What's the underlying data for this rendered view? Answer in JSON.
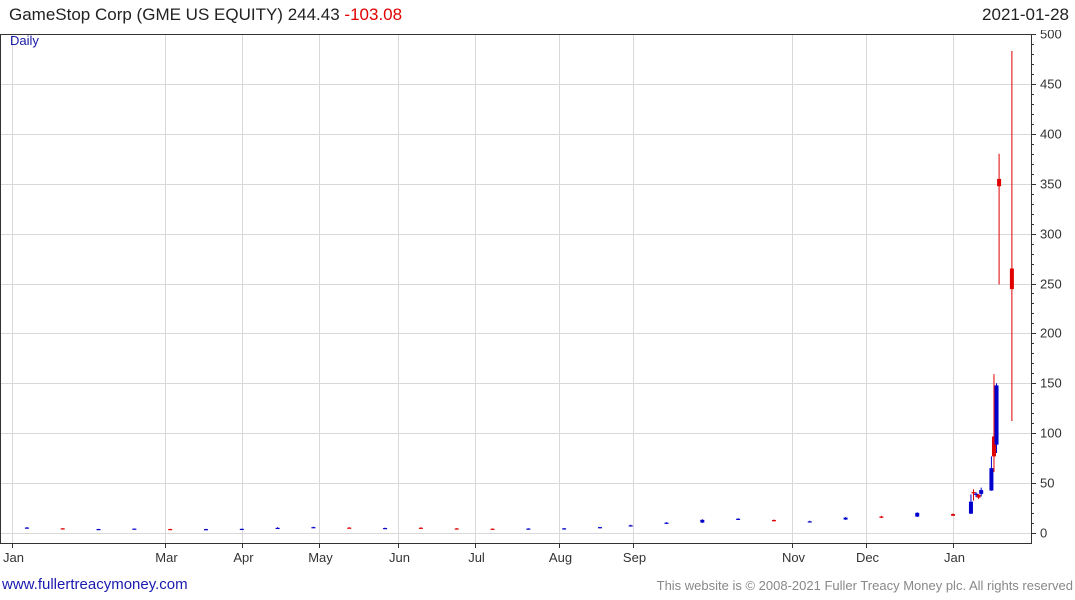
{
  "header": {
    "title": "GameStop Corp (GME US EQUITY)",
    "last_price": "244.43",
    "change": "-103.08",
    "date": "2021-01-28"
  },
  "footer": {
    "website": "www.fullertreacymoney.com",
    "copyright": "This website is © 2008-2021 Fuller Treacy Money plc. All rights reserved"
  },
  "colors": {
    "up": "#0000cc",
    "down": "#e00000",
    "grid": "#d8d8d8",
    "axis": "#333333"
  },
  "chart_data": {
    "type": "candlestick",
    "period_label": "Daily",
    "ylim": [
      -10,
      500
    ],
    "y_ticks": [
      0,
      50,
      100,
      150,
      200,
      250,
      300,
      350,
      400,
      450,
      500
    ],
    "x_ticks": [
      {
        "label": "Jan",
        "date": "2020-01-02"
      },
      {
        "label": "Mar",
        "date": "2020-03-02"
      },
      {
        "label": "Apr",
        "date": "2020-04-01"
      },
      {
        "label": "May",
        "date": "2020-05-01"
      },
      {
        "label": "Jun",
        "date": "2020-06-01"
      },
      {
        "label": "Jul",
        "date": "2020-07-01"
      },
      {
        "label": "Aug",
        "date": "2020-08-03"
      },
      {
        "label": "Sep",
        "date": "2020-09-01"
      },
      {
        "label": "Nov",
        "date": "2020-11-02"
      },
      {
        "label": "Dec",
        "date": "2020-12-01"
      },
      {
        "label": "Jan",
        "date": "2021-01-04"
      }
    ],
    "series": [
      {
        "date": "2020-01-08",
        "open": 5.2,
        "high": 5.9,
        "low": 4.9,
        "close": 5.5
      },
      {
        "date": "2020-01-22",
        "open": 4.7,
        "high": 5.0,
        "low": 4.4,
        "close": 4.5
      },
      {
        "date": "2020-02-05",
        "open": 3.8,
        "high": 4.2,
        "low": 3.5,
        "close": 4.0
      },
      {
        "date": "2020-02-19",
        "open": 4.1,
        "high": 4.5,
        "low": 3.9,
        "close": 4.4
      },
      {
        "date": "2020-03-04",
        "open": 4.0,
        "high": 4.3,
        "low": 3.6,
        "close": 3.7
      },
      {
        "date": "2020-03-18",
        "open": 3.8,
        "high": 4.2,
        "low": 3.2,
        "close": 3.9
      },
      {
        "date": "2020-04-01",
        "open": 3.9,
        "high": 4.4,
        "low": 3.6,
        "close": 4.2
      },
      {
        "date": "2020-04-15",
        "open": 5.0,
        "high": 5.8,
        "low": 4.7,
        "close": 5.2
      },
      {
        "date": "2020-04-29",
        "open": 5.5,
        "high": 6.3,
        "low": 5.2,
        "close": 5.9
      },
      {
        "date": "2020-05-13",
        "open": 5.4,
        "high": 5.9,
        "low": 4.9,
        "close": 5.1
      },
      {
        "date": "2020-05-27",
        "open": 4.9,
        "high": 5.4,
        "low": 4.6,
        "close": 5.0
      },
      {
        "date": "2020-06-10",
        "open": 5.3,
        "high": 5.8,
        "low": 4.9,
        "close": 5.1
      },
      {
        "date": "2020-06-24",
        "open": 4.6,
        "high": 5.0,
        "low": 4.2,
        "close": 4.4
      },
      {
        "date": "2020-07-08",
        "open": 4.3,
        "high": 4.6,
        "low": 3.9,
        "close": 4.1
      },
      {
        "date": "2020-07-22",
        "open": 4.3,
        "high": 4.8,
        "low": 4.1,
        "close": 4.5
      },
      {
        "date": "2020-08-05",
        "open": 4.5,
        "high": 5.0,
        "low": 4.2,
        "close": 4.7
      },
      {
        "date": "2020-08-19",
        "open": 5.2,
        "high": 6.1,
        "low": 5.0,
        "close": 5.9
      },
      {
        "date": "2020-08-31",
        "open": 7.3,
        "high": 8.3,
        "low": 7.0,
        "close": 7.7
      },
      {
        "date": "2020-09-14",
        "open": 9.5,
        "high": 10.8,
        "low": 9.2,
        "close": 10.4
      },
      {
        "date": "2020-09-28",
        "open": 10.5,
        "high": 13.8,
        "low": 10.1,
        "close": 13.2
      },
      {
        "date": "2020-10-12",
        "open": 13.5,
        "high": 14.8,
        "low": 13.0,
        "close": 14.3
      },
      {
        "date": "2020-10-26",
        "open": 13.0,
        "high": 13.6,
        "low": 11.5,
        "close": 12.0
      },
      {
        "date": "2020-11-09",
        "open": 11.2,
        "high": 12.3,
        "low": 10.9,
        "close": 11.7
      },
      {
        "date": "2020-11-23",
        "open": 13.5,
        "high": 15.9,
        "low": 13.2,
        "close": 15.4
      },
      {
        "date": "2020-12-07",
        "open": 16.5,
        "high": 17.2,
        "low": 15.0,
        "close": 15.9
      },
      {
        "date": "2020-12-21",
        "open": 16.5,
        "high": 20.8,
        "low": 16.0,
        "close": 20.2
      },
      {
        "date": "2021-01-04",
        "open": 19.0,
        "high": 19.6,
        "low": 17.1,
        "close": 17.3
      },
      {
        "date": "2021-01-11",
        "open": 19.4,
        "high": 38.7,
        "low": 19.1,
        "close": 31.4
      },
      {
        "date": "2021-01-12",
        "open": 41.0,
        "high": 43.7,
        "low": 32.5,
        "close": 39.9
      },
      {
        "date": "2021-01-13",
        "open": 38.5,
        "high": 40.8,
        "low": 36.0,
        "close": 39.4
      },
      {
        "date": "2021-01-14",
        "open": 38.3,
        "high": 39.2,
        "low": 34.0,
        "close": 35.5
      },
      {
        "date": "2021-01-15",
        "open": 39.2,
        "high": 45.5,
        "low": 36.6,
        "close": 43.0
      },
      {
        "date": "2021-01-19",
        "open": 42.6,
        "high": 76.8,
        "low": 42.3,
        "close": 65.0
      },
      {
        "date": "2021-01-20",
        "open": 96.7,
        "high": 159.2,
        "low": 61.1,
        "close": 76.8
      },
      {
        "date": "2021-01-21",
        "open": 88.6,
        "high": 150.0,
        "low": 80.2,
        "close": 147.9
      },
      {
        "date": "2021-01-22",
        "open": 354.8,
        "high": 380.0,
        "low": 249.0,
        "close": 347.5
      },
      {
        "date": "2021-01-27",
        "open": 265.0,
        "high": 483.0,
        "low": 112.3,
        "close": 244.4
      }
    ]
  }
}
